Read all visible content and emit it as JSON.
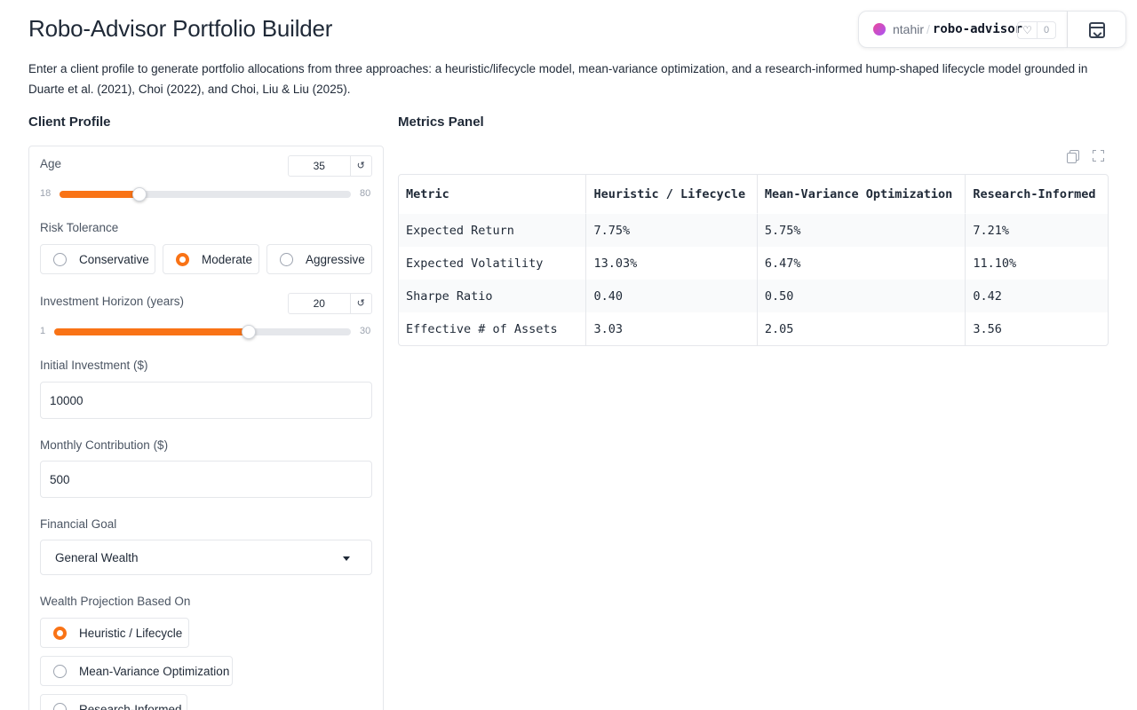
{
  "header": {
    "title": "Robo-Advisor Portfolio Builder",
    "description": "Enter a client profile to generate portfolio allocations from three approaches: a heuristic/lifecycle model, mean-variance optimization, and a research-informed hump-shaped lifecycle model grounded in Duarte et al. (2021), Choi (2022), and Choi, Liu & Liu (2025)."
  },
  "space_badge": {
    "owner": "ntahir",
    "separator": "/",
    "repo": "robo-advisor",
    "likes": "0",
    "icon": "heart-icon"
  },
  "client_profile": {
    "heading": "Client Profile",
    "age": {
      "label": "Age",
      "value": "35",
      "min": "18",
      "max": "80",
      "fraction": 0.274
    },
    "risk": {
      "label": "Risk Tolerance",
      "options": [
        "Conservative",
        "Moderate",
        "Aggressive"
      ],
      "selected": "Moderate"
    },
    "horizon": {
      "label": "Investment Horizon (years)",
      "value": "20",
      "min": "1",
      "max": "30",
      "fraction": 0.655
    },
    "initial": {
      "label": "Initial Investment ($)",
      "value": "10000"
    },
    "monthly": {
      "label": "Monthly Contribution ($)",
      "value": "500"
    },
    "goal": {
      "label": "Financial Goal",
      "value": "General Wealth"
    },
    "projection": {
      "label": "Wealth Projection Based On",
      "options": [
        "Heuristic / Lifecycle",
        "Mean-Variance Optimization",
        "Research-Informed"
      ],
      "selected": "Heuristic / Lifecycle"
    },
    "accent_color": "#f97316"
  },
  "metrics": {
    "heading": "Metrics Panel",
    "columns": [
      "Metric",
      "Heuristic / Lifecycle",
      "Mean-Variance Optimization",
      "Research-Informed"
    ],
    "rows": [
      [
        "Expected Return",
        "7.75%",
        "5.75%",
        "7.21%"
      ],
      [
        "Expected Volatility",
        "13.03%",
        "6.47%",
        "11.10%"
      ],
      [
        "Sharpe Ratio",
        "0.40",
        "0.50",
        "0.42"
      ],
      [
        "Effective # of Assets",
        "3.03",
        "2.05",
        "3.56"
      ]
    ]
  }
}
